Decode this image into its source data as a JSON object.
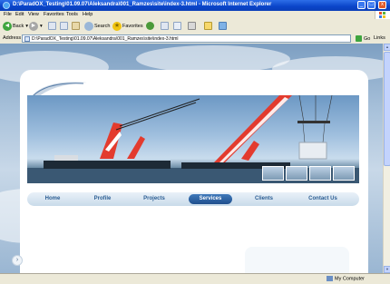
{
  "window": {
    "title": "D:\\ParadOX_Testing\\01.09.07\\Aleksandra\\001_Ramzes\\site\\index-3.html - Microsoft Internet Explorer"
  },
  "menu": [
    "File",
    "Edit",
    "View",
    "Favorites",
    "Tools",
    "Help"
  ],
  "toolbar": {
    "back": "Back",
    "search": "Search",
    "favorites": "Favorites"
  },
  "address": {
    "label": "Address",
    "value": "D:\\ParadOX_Testing\\01.09.07\\Aleksandra\\001_Ramzes\\site\\index-3.html",
    "go": "Go",
    "links": "Links"
  },
  "site": {
    "nav": [
      "Home",
      "Profile",
      "Projects",
      "Services",
      "Clients",
      "Contact Us"
    ],
    "active_nav": "Services"
  },
  "status": {
    "left": "",
    "right": "My Computer"
  },
  "colors": {
    "nav_text": "#2a5c92",
    "nav_active": "#2f66a6",
    "crane_red": "#e33b2e"
  }
}
